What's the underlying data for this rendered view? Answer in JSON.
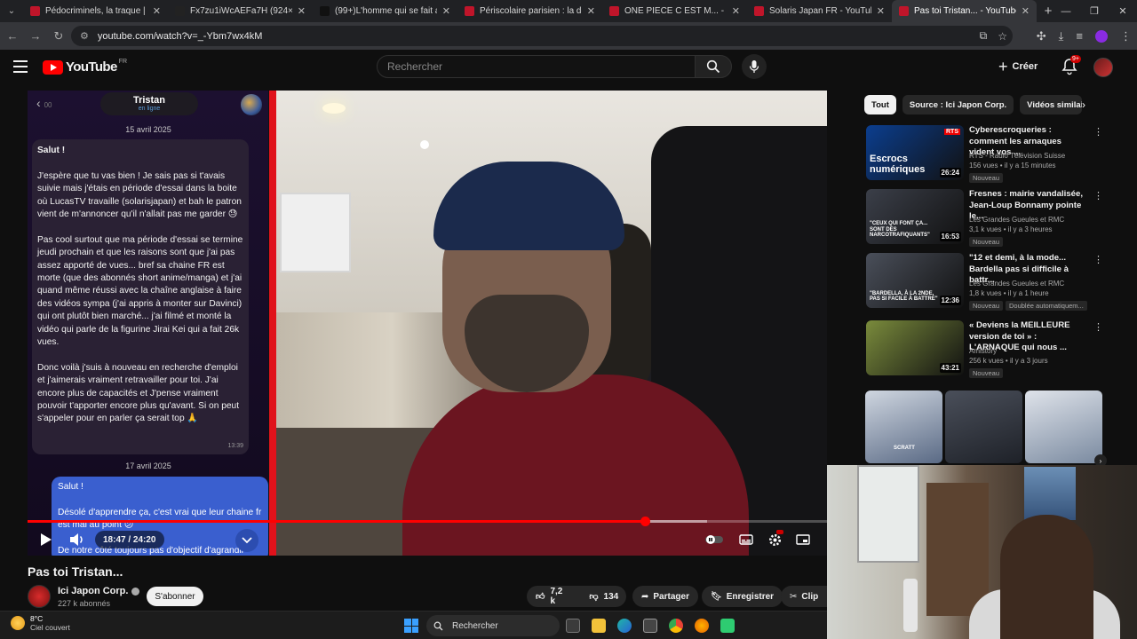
{
  "browser": {
    "tabs": [
      {
        "title": "Pédocriminels, la traque | Docu",
        "color": "#c0152a",
        "icon": "youtube-favicon",
        "active": false
      },
      {
        "title": "Fx7zu1iWcAEFa7H (924×790)",
        "color": "#222222",
        "icon": "x-favicon",
        "active": false
      },
      {
        "title": "(99+)L'homme qui se fait agre",
        "color": "#111111",
        "icon": "tiktok-favicon",
        "active": false
      },
      {
        "title": "Périscolaire parisien : la descen",
        "color": "#c0152a",
        "icon": "youtube-favicon",
        "active": false
      },
      {
        "title": "ONE PIECE C EST M... - LA COM",
        "color": "#c0152a",
        "icon": "youtube-favicon",
        "active": false
      },
      {
        "title": "Solaris Japan FR - YouTube",
        "color": "#c0152a",
        "icon": "youtube-favicon",
        "active": false
      },
      {
        "title": "Pas toi Tristan... - YouTube",
        "color": "#c0152a",
        "icon": "youtube-favicon",
        "active": true
      }
    ],
    "url": "youtube.com/watch?v=_-Ybm7wx4kM"
  },
  "youtube": {
    "logo_text": "YouTube",
    "country": "FR",
    "search_placeholder": "Rechercher",
    "create_label": "Créer",
    "notif_badge": "9+"
  },
  "chat": {
    "contact_name": "Tristan",
    "status": "en ligne",
    "back_preview": "00",
    "date1": "15 avril 2025",
    "message_paragraphs": [
      "Salut !",
      "J'espère que tu vas bien ! Je sais pas si t'avais suivie mais j'étais en période d'essai dans la boite où LucasTV travaille (solarisjapan) et bah le patron vient de m'annoncer qu'il n'allait pas me garder 😓",
      "Pas cool surtout que ma période d'essai se termine jeudi prochain et que les raisons sont que j'ai pas assez apporté de vues... bref sa chaine FR est morte (que des abonnés short anime/manga) et j'ai quand même réussi avec la chaîne anglaise à faire des vidéos sympa (j'ai appris à monter sur Davinci) qui ont plutôt bien marché... j'ai filmé et monté la vidéo qui parle de la figurine Jirai Kei qui a fait 26k vues.",
      "Donc voilà j'suis à nouveau en recherche d'emploi et j'aimerais vraiment retravailler pour toi. J'ai encore plus de capacités et J'pense vraiment pouvoir t'apporter encore plus qu'avant. Si on peut s'appeler pour en parler ça serait top 🙏"
    ],
    "message_time": "13:39",
    "date2": "17 avril 2025",
    "reply_paragraphs": [
      "Salut !",
      "Désolé d'apprendre ça, c'est vrai que leur chaine fr est mal au point 😕",
      "De notre côté toujours pas d'objectif d'agrandir"
    ]
  },
  "player": {
    "current_time": "18:47",
    "duration": "24:20",
    "time_display": "18:47 / 24:20",
    "progress_fraction": 0.772,
    "buffer_fraction": 0.85
  },
  "video": {
    "title": "Pas toi Tristan...",
    "channel": "Ici Japon Corp.",
    "subscribers": "227 k abonnés",
    "subscribe_label": "S'abonner",
    "likes": "7,2 k",
    "dislikes": "134",
    "share_label": "Partager",
    "save_label": "Enregistrer",
    "clip_label": "Clip"
  },
  "sidebar": {
    "chips": [
      "Tout",
      "Source : Ici Japon Corp.",
      "Vidéos similaires"
    ],
    "recommendations": [
      {
        "title": "Cyberescroqueries : comment les arnaques vident vos ...",
        "channel": "RTS - Radio Télévision Suisse",
        "meta": "156 vues • il y a 15 minutes",
        "badge": "Nouveau",
        "duration": "26:24",
        "thumb_text": "Escrocs numériques",
        "thumb_tag": "RTS",
        "thumb_bg": "#0b3e8f"
      },
      {
        "title": "Fresnes : mairie vandalisée, Jean-Loup Bonnamy pointe le...",
        "channel": "Les Grandes Gueules et RMC",
        "meta": "3,1 k vues • il y a 3 heures",
        "badge": "Nouveau",
        "duration": "16:53",
        "thumb_text": "\"CEUX QUI FONT ÇA... SONT DES NARCOTRAFIQUANTS\"",
        "thumb_tag": "",
        "thumb_bg": "#3b3f49"
      },
      {
        "title": "\"12 et demi, à la mode... Bardella pas si difficile à battr...",
        "channel": "Les Grandes Gueules et RMC",
        "meta": "1,8 k vues • il y a 1 heure",
        "badge": "Nouveau",
        "badge2": "Doublée automatiquem...",
        "duration": "12:36",
        "thumb_text": "\"BARDELLA, À LA 2NDE, PAS SI FACILE À BATTRE\"",
        "thumb_tag": "",
        "thumb_bg": "#4a4f5a"
      },
      {
        "title": "« Deviens la MEILLEURE version de toi » : L'ARNAQUE qui nous ...",
        "channel": "Amistory",
        "meta": "256 k vues • il y a 3 jours",
        "badge": "Nouveau",
        "duration": "43:21",
        "thumb_text": "",
        "thumb_tag": "",
        "thumb_bg": "#7a8b3c"
      }
    ],
    "shorts_overlay": "SCRATT"
  },
  "taskbar": {
    "temperature": "8°C",
    "weather": "Ciel couvert",
    "search_label": "Rechercher"
  }
}
